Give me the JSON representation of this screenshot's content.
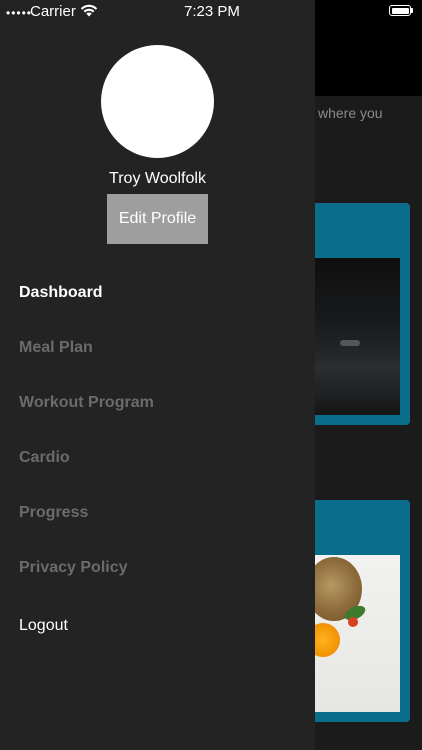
{
  "status_bar": {
    "signal": "•••••",
    "carrier": "Carrier",
    "time": "7:23 PM"
  },
  "background": {
    "partial_text": "where you"
  },
  "drawer": {
    "profile_name": "Troy Woolfolk",
    "edit_profile_label": "Edit Profile",
    "menu": [
      {
        "label": "Dashboard",
        "active": true
      },
      {
        "label": "Meal Plan",
        "active": false
      },
      {
        "label": "Workout Program",
        "active": false
      },
      {
        "label": "Cardio",
        "active": false
      },
      {
        "label": "Progress",
        "active": false
      },
      {
        "label": "Privacy Policy",
        "active": false
      }
    ],
    "logout_label": "Logout"
  },
  "colors": {
    "drawer_bg": "#232323",
    "active_item": "#ffffff",
    "inactive_item": "#6b6b6b",
    "button_bg": "#9e9e9e",
    "card_accent": "#0b6d8c"
  }
}
